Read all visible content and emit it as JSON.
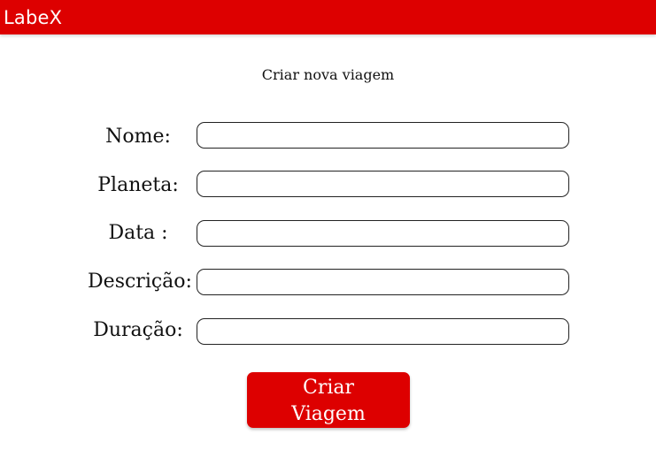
{
  "colors": {
    "accent": "#dd0000",
    "text": "#111111",
    "background": "#ffffff"
  },
  "header": {
    "logo": "LabeX"
  },
  "form": {
    "title": "Criar nova viagem",
    "fields": [
      {
        "label": "Nome:",
        "value": ""
      },
      {
        "label": "Planeta:",
        "value": ""
      },
      {
        "label": "Data :",
        "value": ""
      },
      {
        "label": "Descrição:",
        "value": ""
      },
      {
        "label": "Duração:",
        "value": ""
      }
    ],
    "submit_label": "Criar Viagem"
  }
}
